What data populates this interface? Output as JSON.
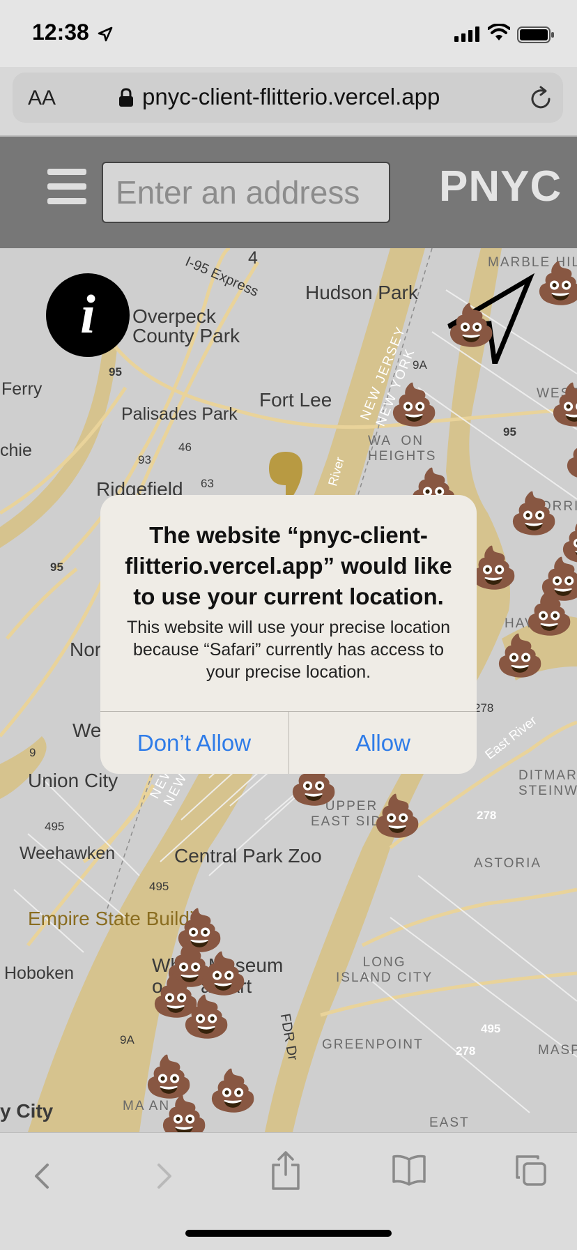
{
  "status_bar": {
    "time": "12:38",
    "icons": [
      "location-arrow-icon",
      "signal-icon",
      "wifi-icon",
      "battery-icon"
    ]
  },
  "browser": {
    "text_size_button": "AA",
    "url": "pnyc-client-flitterio.vercel.app",
    "icons": [
      "lock-icon",
      "reload-icon"
    ]
  },
  "app_header": {
    "menu_icon": "hamburger-menu-icon",
    "address_placeholder": "Enter an address",
    "brand": "PNYC"
  },
  "map": {
    "labels": {
      "interstate_4": "4",
      "i95_express": "I-95 Express",
      "hudson_park": "Hudson Park",
      "marble_hill": "MARBLE HIL",
      "overpeck_county_park": "Overpeck\nCounty Park",
      "ferry": "Ferry",
      "i95_a": "95",
      "fort_lee": "Fort Lee",
      "new_jersey_new_york": "NEW JERSEY\nNEW YORK",
      "route_9a_top": "9A",
      "west": "WEST",
      "palisades_park": "Palisades Park",
      "washington_heights": "WA  ON\nHEIGHTS",
      "i95_b": "95",
      "chie": "chie",
      "route_93": "93",
      "route_46": "46",
      "ridgefield": "Ridgefield",
      "route_63": "63",
      "morrisania": "MORRISA",
      "i95_c": "95",
      "haven": "HAVEN",
      "nor": "Nor",
      "route_278_top": "278",
      "wes": "Wes",
      "east_river": "East River",
      "route_9": "9",
      "union_city": "Union City",
      "ditmars_steinway": "DITMAR\nSTEINWA",
      "nj_ny_lower": "NEW J\nNEW Y",
      "upper_east_side": "UPPER\nEAST SIDE",
      "route_278_mid": "278",
      "route_495_left": "495",
      "weehawken": "Weehawken",
      "central_park_zoo": "Central Park Zoo",
      "astoria": "ASTORIA",
      "route_495_mid": "495",
      "empire_state": "Empire State Buildi",
      "hoboken": "Hoboken",
      "whitney_museum": "Wh     Museum\no       an Art",
      "long_island_city": "LONG\nISLAND CITY",
      "fdr_dr": "FDR Dr",
      "route_495_right": "495",
      "route_9a_bottom": "9A",
      "greenpoint": "GREENPOINT",
      "route_278_bottom": "278",
      "maspeth": "MASPET",
      "city": "y City",
      "manhattan": "MA        AN",
      "east": "EAST",
      "river_label": "River"
    },
    "info_button": "i",
    "markers_emoji": "💩"
  },
  "dialog": {
    "title": "The website “pnyc-client-flitterio.vercel.app” would like to use your current location.",
    "message": "This website will use your precise location because “Safari” currently has access to your precise location.",
    "deny_label": "Don’t Allow",
    "allow_label": "Allow"
  },
  "toolbar": {
    "icons": [
      "back-icon",
      "forward-icon",
      "share-icon",
      "bookmarks-icon",
      "tabs-icon"
    ]
  },
  "colors": {
    "header_bg": "#777777",
    "dialog_button": "#2f7ce8",
    "map_water": "#d6c38e"
  }
}
